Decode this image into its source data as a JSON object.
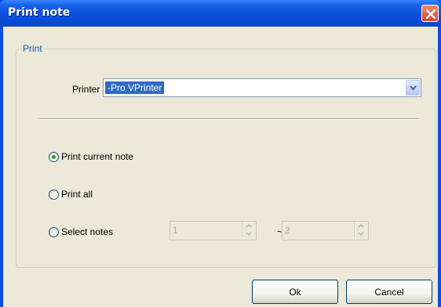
{
  "window": {
    "title": "Print note",
    "close_icon": "close-icon"
  },
  "group": {
    "legend": "Print"
  },
  "printer": {
    "label": "Printer",
    "selected": "-Pro VPrinter"
  },
  "options": {
    "current": "Print current note",
    "all": "Print all",
    "select": "Select notes",
    "selected_option": "current"
  },
  "range": {
    "from": "1",
    "separator": "~",
    "to": "2"
  },
  "buttons": {
    "ok": "Ok",
    "cancel": "Cancel"
  }
}
